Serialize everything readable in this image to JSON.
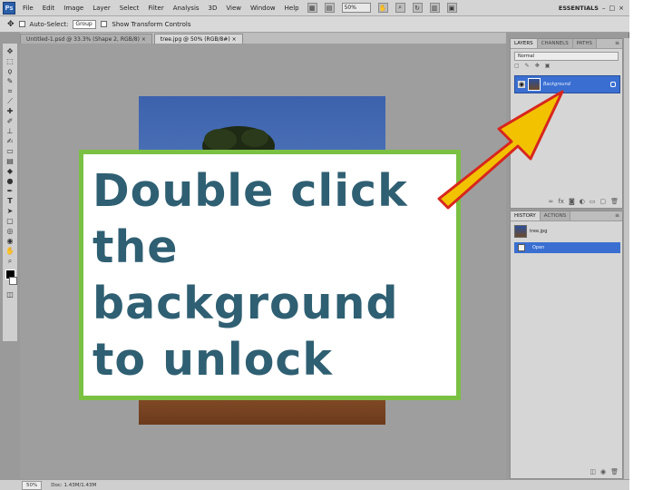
{
  "menubar": {
    "logo": "Ps",
    "items": [
      "File",
      "Edit",
      "Image",
      "Layer",
      "Select",
      "Filter",
      "Analysis",
      "3D",
      "View",
      "Window",
      "Help"
    ],
    "zoom": "50%",
    "workspace": "ESSENTIALS",
    "window_buttons": [
      "–",
      "□",
      "×"
    ]
  },
  "options": {
    "auto_select_label": "Auto-Select:",
    "auto_select_value": "Group",
    "transform_label": "Show Transform Controls"
  },
  "tabs": [
    {
      "label": "Untitled-1.psd @ 33.3% (Shape 2, RGB/8) ×",
      "active": false
    },
    {
      "label": "tree.jpg @ 50% (RGB/8#) ×",
      "active": true
    }
  ],
  "callout": {
    "lines": [
      "Double click",
      "the",
      "background",
      "to unlock"
    ]
  },
  "layers_panel": {
    "tabs": [
      "LAYERS",
      "CHANNELS",
      "PATHS"
    ],
    "blend_mode": "Normal",
    "layer_name": "Background"
  },
  "history_panel": {
    "tabs": [
      "HISTORY",
      "ACTIONS"
    ],
    "snapshot": "tree.jpg",
    "step": "Open"
  },
  "status": {
    "zoom": "50%",
    "doc": "Doc: 1.43M/1.43M"
  },
  "colors": {
    "callout_border": "#7ac143",
    "callout_text": "#2f5f72",
    "arrow_fill": "#f2c200",
    "arrow_stroke": "#d7261e",
    "selection": "#3a6fd1"
  }
}
